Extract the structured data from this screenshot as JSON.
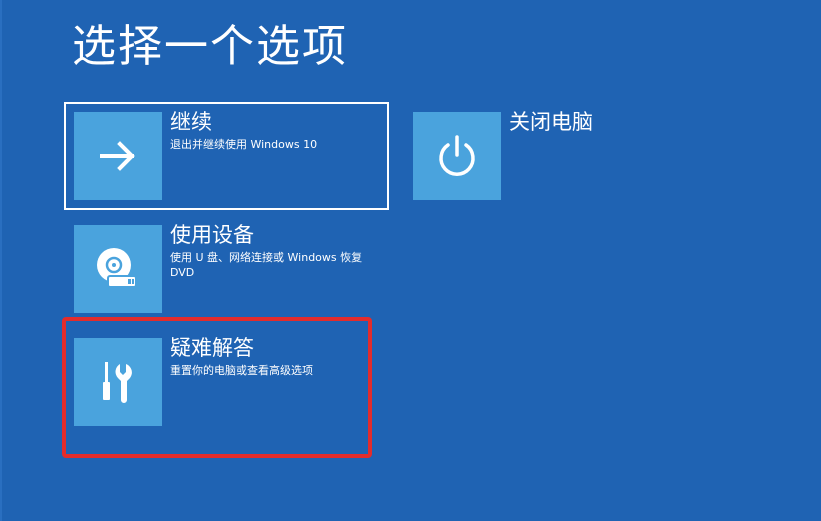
{
  "page": {
    "title": "选择一个选项"
  },
  "options": {
    "continue": {
      "title": "继续",
      "description": "退出并继续使用 Windows 10",
      "icon": "arrow-right-icon"
    },
    "shutdown": {
      "title": "关闭电脑",
      "icon": "power-icon"
    },
    "use_device": {
      "title": "使用设备",
      "description": "使用 U 盘、网络连接或 Windows 恢复 DVD",
      "icon": "disc-drive-icon"
    },
    "troubleshoot": {
      "title": "疑难解答",
      "description": "重置你的电脑或查看高级选项",
      "icon": "tools-icon"
    }
  },
  "colors": {
    "background": "#1f63b3",
    "tile": "#4aa3dd",
    "highlight_border": "#e32c2c",
    "text": "#ffffff"
  }
}
